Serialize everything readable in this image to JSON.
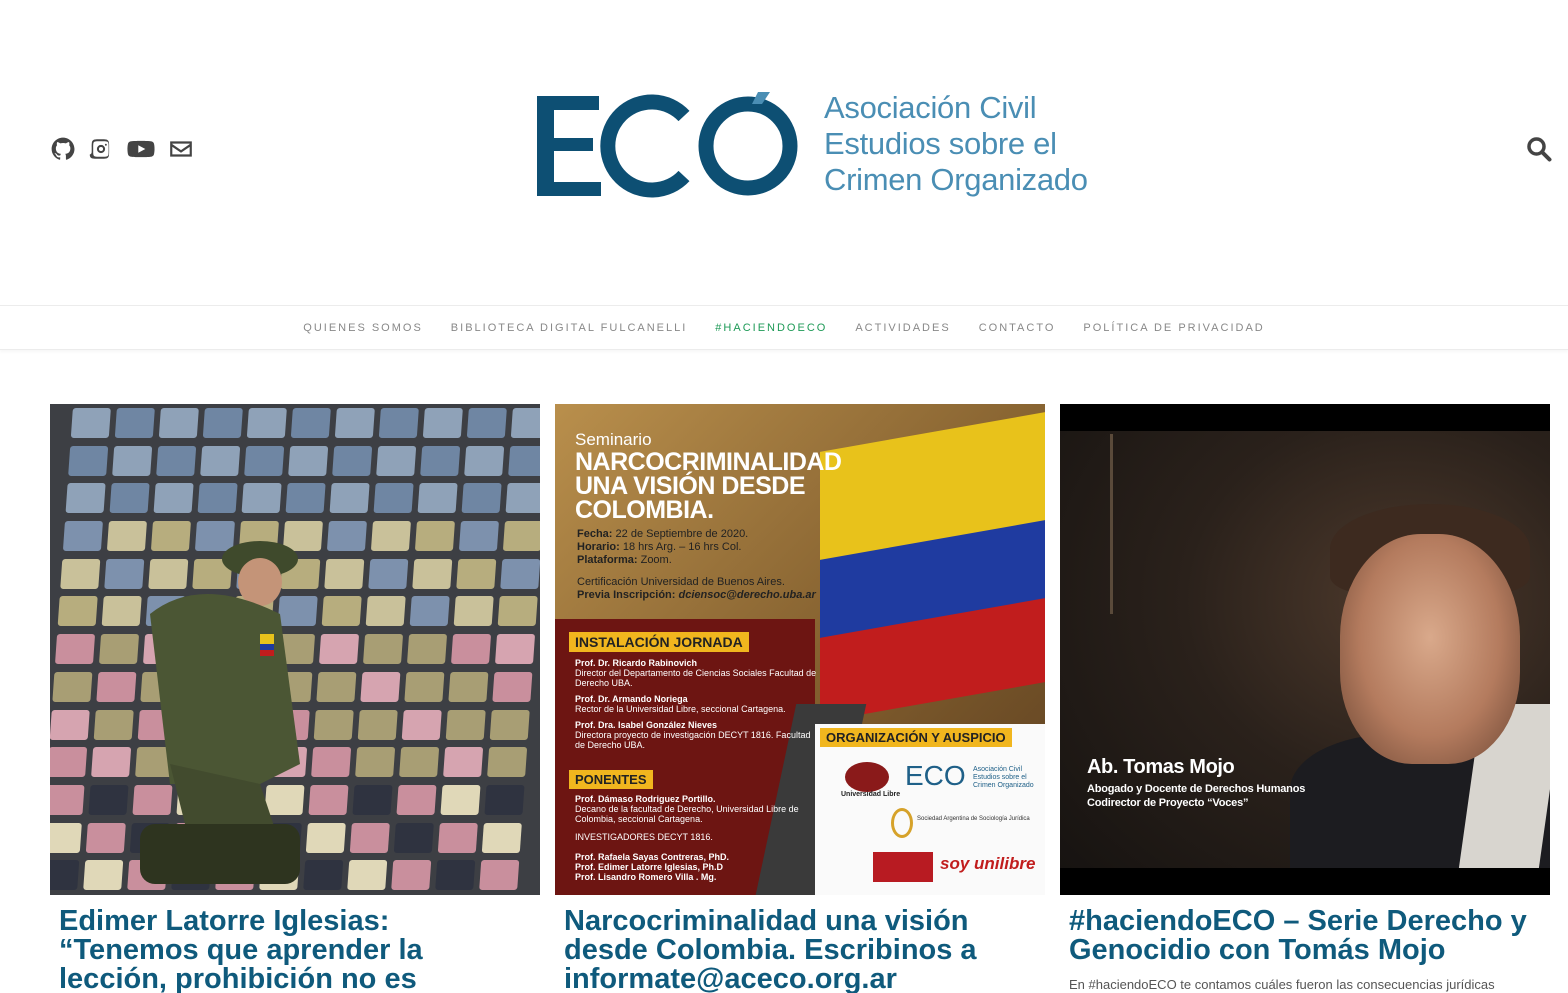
{
  "header": {
    "social_icons": [
      "github-icon",
      "instagram-icon",
      "youtube-icon",
      "envelope-icon"
    ],
    "logo": {
      "mark_text": "ECO",
      "tagline_lines": [
        "Asociación Civil",
        "Estudios sobre el",
        "Crimen Organizado"
      ]
    },
    "search_icon": "search-icon"
  },
  "colors": {
    "logo_dark": "#0d4f73",
    "logo_light": "#4a8eb4",
    "nav_active": "#1e9a57",
    "title": "#0f5a7c"
  },
  "nav": {
    "items": [
      {
        "label": "QUIENES SOMOS"
      },
      {
        "label": "BIBLIOTECA DIGITAL FULCANELLI"
      },
      {
        "label": "#HACIENDOECO",
        "active": true
      },
      {
        "label": "ACTIVIDADES"
      },
      {
        "label": "CONTACTO"
      },
      {
        "label": "POLÍTICA DE PRIVACIDAD"
      }
    ]
  },
  "posts": [
    {
      "title": "Edimer Latorre Iglesias: “Tenemos que aprender la lección, prohibición no es",
      "excerpt": ""
    },
    {
      "title": "Narcocriminalidad una visión desde Colombia. Escribinos a informate@aceco.org.ar",
      "excerpt": "",
      "poster": {
        "kicker": "Seminario",
        "headline": [
          "NARCOCRIMINALIDAD",
          "UNA VISIÓN DESDE",
          "COLOMBIA."
        ],
        "details": [
          {
            "label": "Fecha:",
            "value": "22 de Septiembre de 2020."
          },
          {
            "label": "Horario:",
            "value": "18 hrs Arg. – 16 hrs Col."
          },
          {
            "label": "Plataforma:",
            "value": "Zoom."
          }
        ],
        "cert": "Certificación Universidad de Buenos Aires.",
        "inscription_label": "Previa Inscripción:",
        "inscription_email": "dciensoc@derecho.uba.ar",
        "section_install": "INSTALACIÓN JORNADA",
        "install_people": [
          {
            "name": "Prof. Dr. Ricardo Rabinovich",
            "role": "Director del Departamento de Ciencias Sociales Facultad de Derecho UBA."
          },
          {
            "name": "Prof. Dr. Armando Noriega",
            "role": "Rector de la Universidad Libre, seccional Cartagena."
          },
          {
            "name": "Prof. Dra. Isabel González Nieves",
            "role": "Directora proyecto de investigación DECYT 1816. Facultad de Derecho UBA."
          }
        ],
        "section_speakers": "PONENTES",
        "speaker": {
          "name": "Prof. Dámaso Rodriguez Portillo.",
          "role": "Decano de la facultad de Derecho, Universidad Libre de Colombia, seccional Cartagena."
        },
        "researchers_label": "INVESTIGADORES DECYT 1816.",
        "researchers": [
          "Prof. Rafaela Sayas Contreras, PhD.",
          "Prof. Edimer Latorre Iglesias, Ph.D",
          "Prof. Lisandro Romero Villa . Mg."
        ],
        "section_org": "ORGANIZACIÓN Y AUSPICIO",
        "sponsors": [
          "Universidad Libre",
          "ECO",
          "Asociación Civil Estudios sobre el Crimen Organizado",
          "Sociedad Argentina de Sociología Jurídica",
          "soy unilibre"
        ]
      }
    },
    {
      "title": "#haciendoECO – Serie Derecho y Genocidio con Tomás Mojo",
      "excerpt": "En #haciendoECO te contamos cuáles fueron las consecuencias jurídicas",
      "caption_name": "Ab. Tomas Mojo",
      "caption_role_1": "Abogado y Docente de Derechos Humanos",
      "caption_role_2": "Codirector de Proyecto “Voces”"
    }
  ]
}
